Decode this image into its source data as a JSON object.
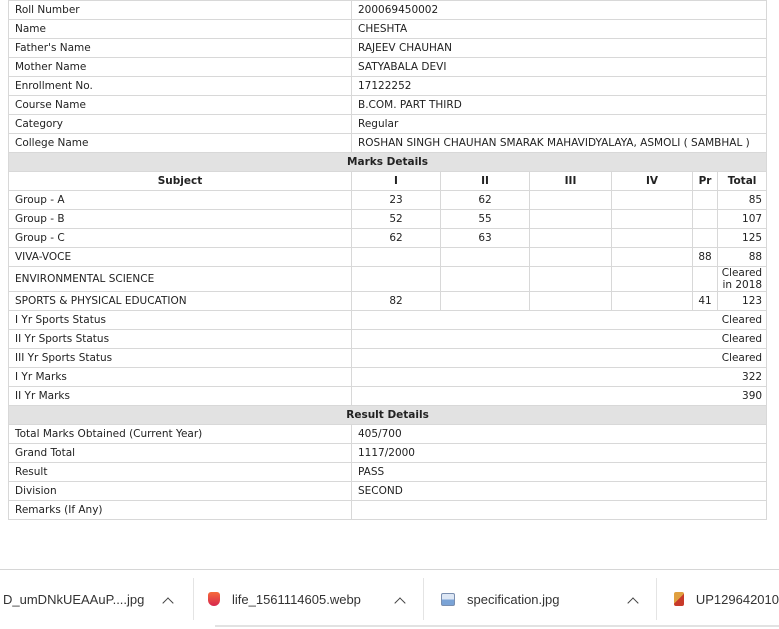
{
  "student": [
    {
      "label": "Roll Number",
      "value": "200069450002"
    },
    {
      "label": "Name",
      "value": "CHESHTA"
    },
    {
      "label": "Father's Name",
      "value": "RAJEEV CHAUHAN"
    },
    {
      "label": "Mother Name",
      "value": "SATYABALA DEVI"
    },
    {
      "label": "Enrollment No.",
      "value": "17122252"
    },
    {
      "label": "Course Name",
      "value": "B.COM. PART THIRD"
    },
    {
      "label": "Category",
      "value": "Regular"
    },
    {
      "label": "College Name",
      "value": "ROSHAN SINGH CHAUHAN SMARAK MAHAVIDYALAYA, ASMOLI ( SAMBHAL )"
    }
  ],
  "marks": {
    "title": "Marks Details",
    "headers": {
      "subject": "Subject",
      "i": "I",
      "ii": "II",
      "iii": "III",
      "iv": "IV",
      "pr": "Pr",
      "total": "Total"
    },
    "rows": [
      {
        "subject": "Group - A",
        "i": "23",
        "ii": "62",
        "iii": "",
        "iv": "",
        "pr": "",
        "total": "85"
      },
      {
        "subject": "Group - B",
        "i": "52",
        "ii": "55",
        "iii": "",
        "iv": "",
        "pr": "",
        "total": "107"
      },
      {
        "subject": "Group - C",
        "i": "62",
        "ii": "63",
        "iii": "",
        "iv": "",
        "pr": "",
        "total": "125"
      },
      {
        "subject": "VIVA-VOCE",
        "i": "",
        "ii": "",
        "iii": "",
        "iv": "",
        "pr": "88",
        "total": "88"
      },
      {
        "subject": "ENVIRONMENTAL SCIENCE",
        "i": "",
        "ii": "",
        "iii": "",
        "iv": "",
        "pr": "",
        "total": "Cleared in 2018"
      },
      {
        "subject": "SPORTS & PHYSICAL EDUCATION",
        "i": "82",
        "ii": "",
        "iii": "",
        "iv": "",
        "pr": "41",
        "total": "123"
      }
    ],
    "status": [
      {
        "label": "I Yr Sports Status",
        "value": "Cleared"
      },
      {
        "label": "II Yr Sports Status",
        "value": "Cleared"
      },
      {
        "label": "III Yr Sports Status",
        "value": "Cleared"
      },
      {
        "label": "I Yr Marks",
        "value": "322"
      },
      {
        "label": "II Yr Marks",
        "value": "390"
      }
    ]
  },
  "result": {
    "title": "Result Details",
    "rows": [
      {
        "label": "Total Marks Obtained (Current Year)",
        "value": "405/700"
      },
      {
        "label": "Grand Total",
        "value": "1117/2000"
      },
      {
        "label": "Result",
        "value": "PASS"
      },
      {
        "label": "Division",
        "value": "SECOND"
      },
      {
        "label": "Remarks (If Any)",
        "value": ""
      }
    ]
  },
  "downloads": [
    {
      "name": "D_umDNkUEAAuP....jpg",
      "icon": "image-icon"
    },
    {
      "name": "life_1561114605.webp",
      "icon": "webp-file-icon"
    },
    {
      "name": "specification.jpg",
      "icon": "image-icon"
    },
    {
      "name": "UP129642010",
      "icon": "image-file-icon"
    }
  ]
}
